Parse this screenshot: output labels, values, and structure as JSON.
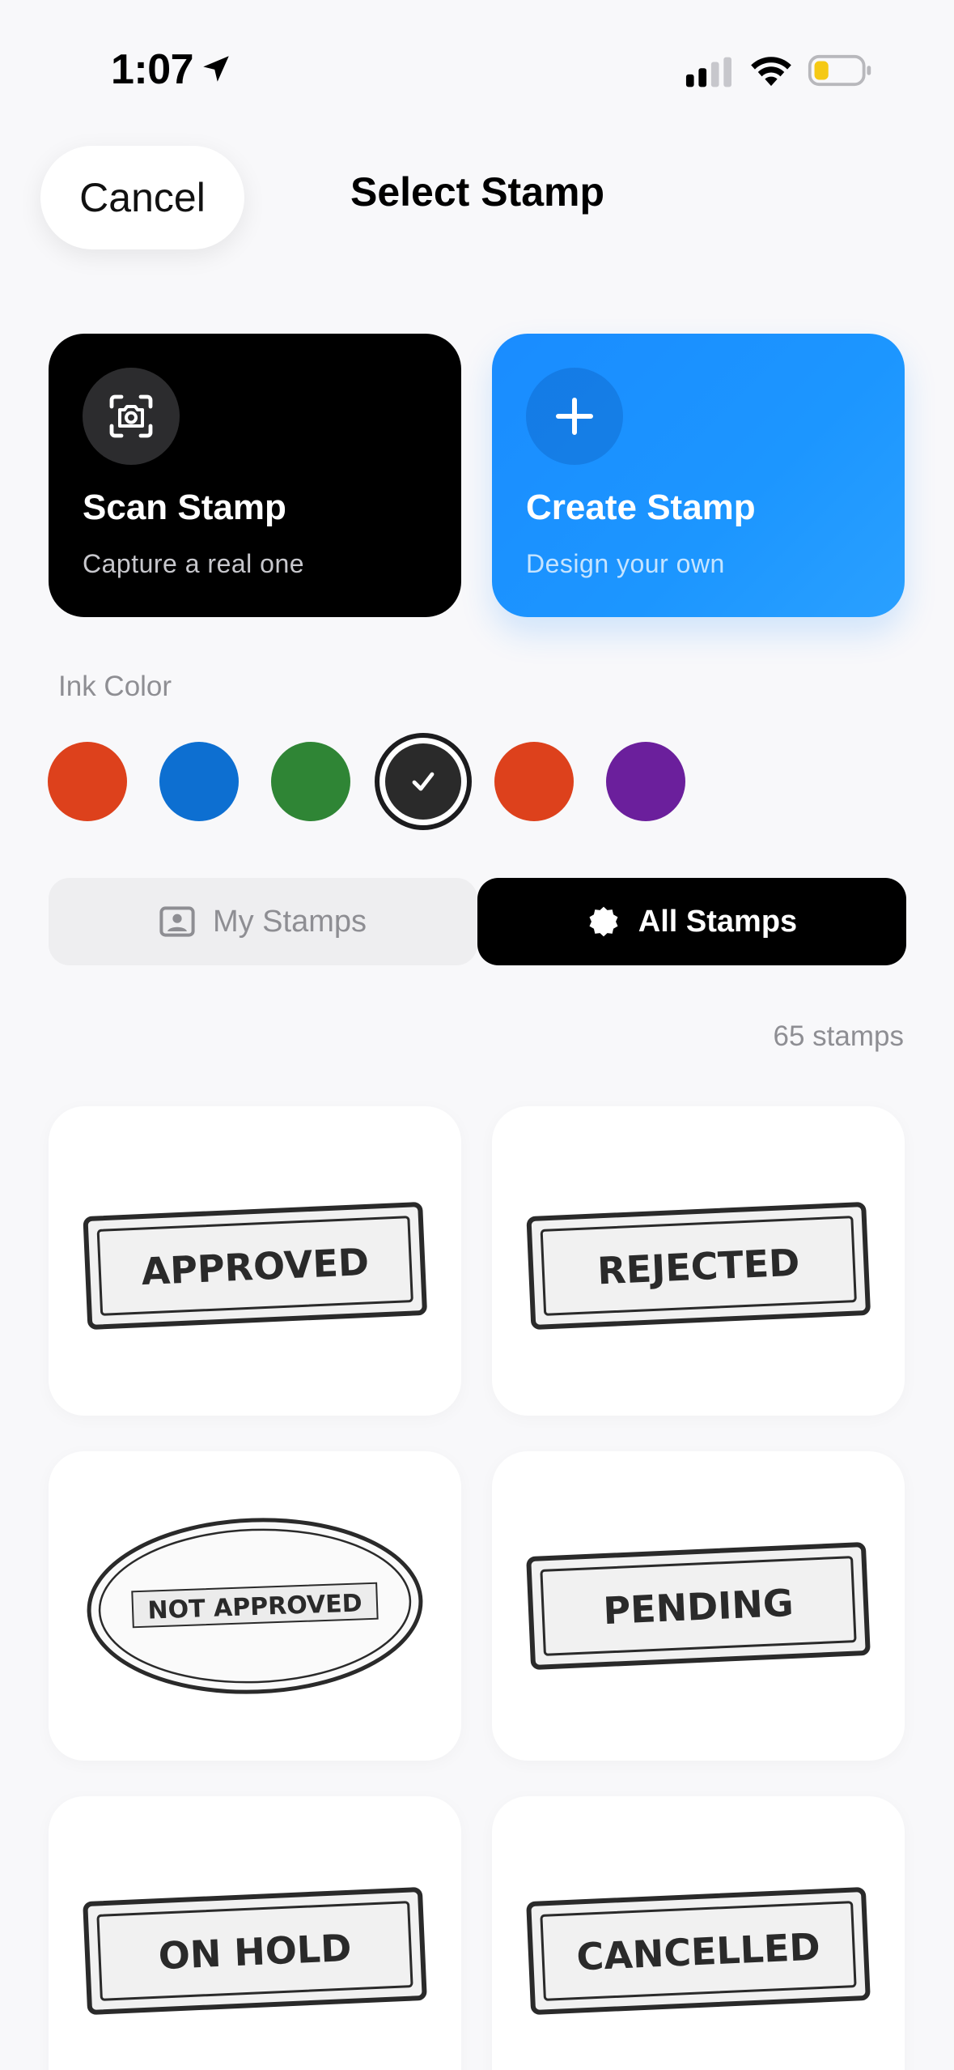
{
  "status_bar": {
    "time": "1:07"
  },
  "header": {
    "cancel_label": "Cancel",
    "title": "Select Stamp"
  },
  "actions": [
    {
      "title": "Scan Stamp",
      "subtitle": "Capture a real one",
      "icon": "camera-scan-icon"
    },
    {
      "title": "Create Stamp",
      "subtitle": "Design your own",
      "icon": "plus-icon"
    }
  ],
  "ink": {
    "label": "Ink Color",
    "colors": [
      "#dd411c",
      "#0d6fd1",
      "#2f8535",
      "#2a2a2a",
      "#dd411c",
      "#6b1f9c"
    ],
    "selected_index": 3
  },
  "tabs": {
    "my_stamps": "My Stamps",
    "all_stamps": "All Stamps",
    "active": "all_stamps"
  },
  "stamp_count": "65 stamps",
  "stamps": [
    {
      "label": "APPROVED",
      "shape": "rectangle"
    },
    {
      "label": "REJECTED",
      "shape": "rectangle"
    },
    {
      "label": "NOT APPROVED",
      "shape": "oval"
    },
    {
      "label": "PENDING",
      "shape": "rectangle"
    },
    {
      "label": "ON HOLD",
      "shape": "rectangle"
    },
    {
      "label": "CANCELLED",
      "shape": "rectangle"
    }
  ]
}
